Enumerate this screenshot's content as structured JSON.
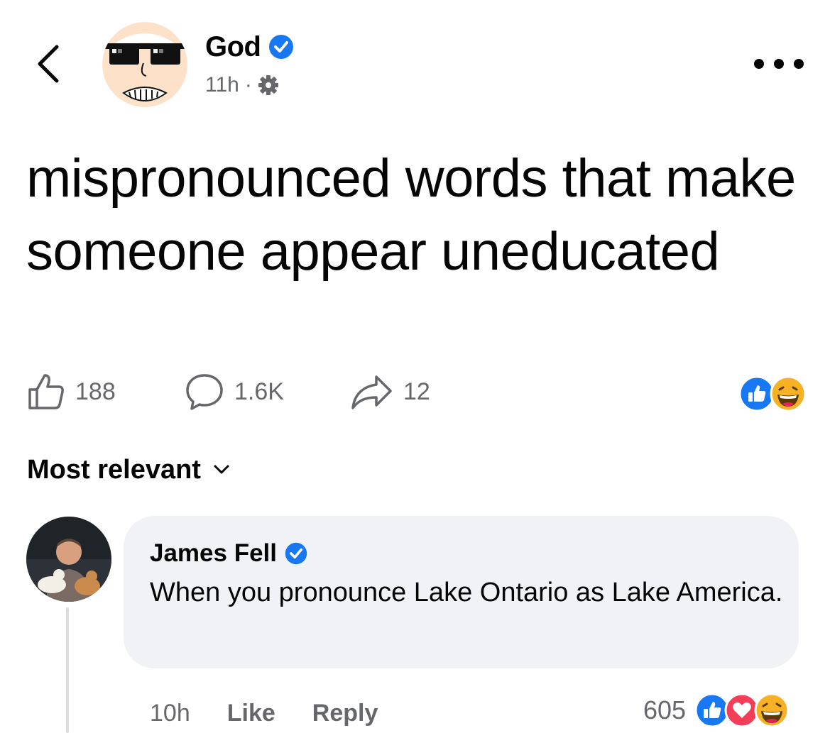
{
  "post": {
    "author": "God",
    "verified": true,
    "time": "11h",
    "separator": "·",
    "privacy_icon": "gear-icon",
    "text": "mispronounced words that make someone appear uneducated"
  },
  "actions": {
    "like_count": "188",
    "comment_count": "1.6K",
    "share_count": "12",
    "reactions": [
      "like-icon",
      "haha-icon"
    ]
  },
  "sort": {
    "label": "Most relevant"
  },
  "comment": {
    "author": "James Fell",
    "verified": true,
    "text": "When you pronounce Lake Ontario as Lake America.",
    "time": "10h",
    "like_label": "Like",
    "reply_label": "Reply",
    "reaction_count": "605",
    "reactions": [
      "like-icon",
      "love-icon",
      "haha-icon"
    ]
  },
  "colors": {
    "text": "#050505",
    "secondary": "#65676b",
    "verified": "#1877f2",
    "bubble": "#f0f2f5",
    "love": "#f33e58",
    "haha": "#f7b125"
  }
}
